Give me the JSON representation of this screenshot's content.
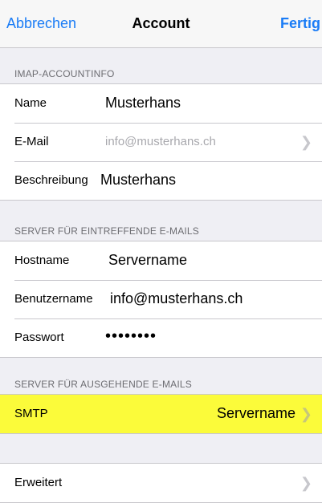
{
  "nav": {
    "cancel_label": "Abbrechen",
    "title": "Account",
    "done_label": "Fertig"
  },
  "imap_section": {
    "header": "IMAP-ACCOUNTINFO",
    "name_label": "Name",
    "name_value": "Musterhans",
    "email_label": "E-Mail",
    "email_value": "info@musterhans.ch",
    "description_label": "Beschreibung",
    "description_value": "Musterhans"
  },
  "incoming_section": {
    "header": "SERVER FÜR EINTREFFENDE E-MAILS",
    "hostname_label": "Hostname",
    "hostname_value": "Servername",
    "username_label": "Benutzername",
    "username_value": "info@musterhans.ch",
    "password_label": "Passwort",
    "password_value": "••••••••"
  },
  "outgoing_section": {
    "header": "SERVER FÜR AUSGEHENDE E-MAILS",
    "smtp_label": "SMTP",
    "smtp_value": "Servername",
    "highlight_color": "#fbfb3a"
  },
  "advanced_section": {
    "advanced_label": "Erweitert"
  },
  "colors": {
    "accent": "#1a7cf6",
    "background": "#efeff4",
    "separator": "#c8c7cc"
  },
  "icons": {
    "chevron": "chevron-right-icon"
  }
}
